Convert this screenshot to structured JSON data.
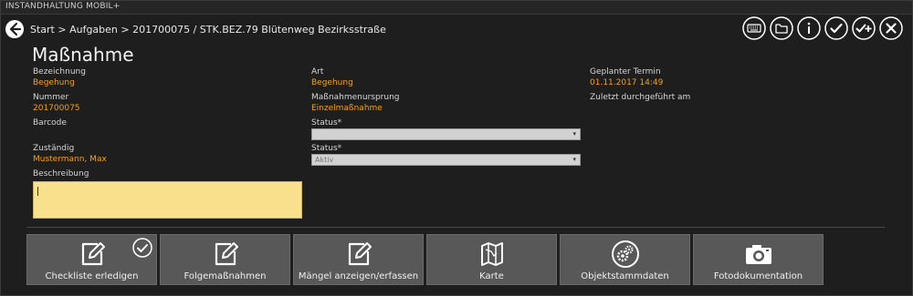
{
  "app": {
    "title": "INSTANDHALTUNG MOBIL+"
  },
  "breadcrumb": "Start > Aufgaben > 201700075 / STK.BEZ.79 Blütenweg Bezirksstraße",
  "toolbar": {
    "icons": [
      "keyboard-icon",
      "folder-icon",
      "info-icon",
      "check-icon",
      "check-plus-icon",
      "close-icon"
    ]
  },
  "page": {
    "title": "Maßnahme"
  },
  "fields": {
    "bezeichnung": {
      "label": "Bezeichnung",
      "value": "Begehung"
    },
    "nummer": {
      "label": "Nummer",
      "value": "201700075"
    },
    "barcode": {
      "label": "Barcode"
    },
    "zustaendig": {
      "label": "Zuständig",
      "value": "Mustermann, Max"
    },
    "beschreibung": {
      "label": "Beschreibung",
      "value": ""
    },
    "art": {
      "label": "Art",
      "value": "Begehung"
    },
    "ursprung": {
      "label": "Maßnahmenursprung",
      "value": "Einzelmaßnahme"
    },
    "status1": {
      "label": "Status*",
      "value": ""
    },
    "status2": {
      "label": "Status*",
      "value": "Aktiv"
    },
    "termin": {
      "label": "Geplanter Termin",
      "value": "01.11.2017 14:49"
    },
    "zuletzt": {
      "label": "Zuletzt durchgeführt am"
    }
  },
  "tiles": [
    {
      "label": "Checkliste erledigen",
      "icon": "edit-icon",
      "checked": true
    },
    {
      "label": "Folgemaßnahmen",
      "icon": "edit-icon"
    },
    {
      "label": "Mängel anzeigen/erfassen",
      "icon": "edit-icon"
    },
    {
      "label": "Karte",
      "icon": "map-icon"
    },
    {
      "label": "Objektstammdaten",
      "icon": "gears-icon"
    },
    {
      "label": "Fotodokumentation",
      "icon": "camera-icon"
    }
  ],
  "colors": {
    "accent": "#f0a316",
    "textarea": "#f8e08c",
    "tile": "#585858",
    "background": "#1e1e1e"
  }
}
